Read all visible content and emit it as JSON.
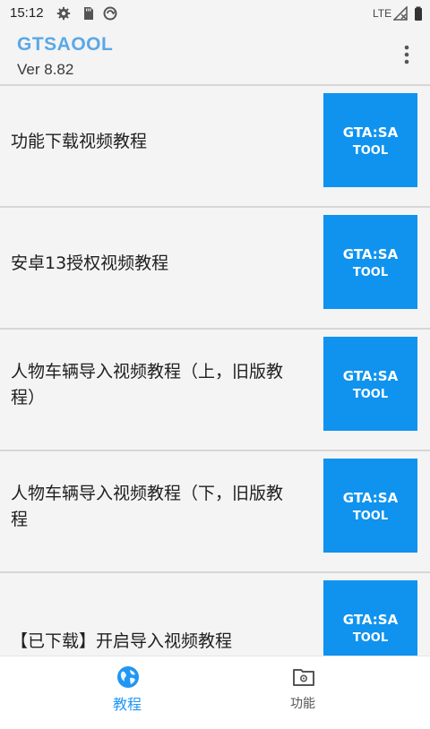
{
  "status_bar": {
    "time": "15:12",
    "network": "LTE",
    "icons": [
      "gear-icon",
      "sd-card-icon",
      "sync-circle-icon",
      "signal-icon",
      "battery-icon"
    ]
  },
  "app_bar": {
    "title": "GTSAOOL",
    "version": "Ver 8.82",
    "menu_icon": "more-vert-icon"
  },
  "items": [
    {
      "label": "功能下载视频教程",
      "thumb_line1": "GTA:SA",
      "thumb_line2": "TOOL"
    },
    {
      "label": "安卓13授权视频教程",
      "thumb_line1": "GTA:SA",
      "thumb_line2": "TOOL"
    },
    {
      "label": "人物车辆导入视频教程（上，旧版教程）",
      "thumb_line1": "GTA:SA",
      "thumb_line2": "TOOL"
    },
    {
      "label": "人物车辆导入视频教程（下，旧版教程",
      "thumb_line1": "GTA:SA",
      "thumb_line2": "TOOL"
    },
    {
      "label": "【已下载】开启导入视频教程",
      "thumb_line1": "GTA:SA",
      "thumb_line2": "TOOL"
    }
  ],
  "bottom_nav": {
    "tabs": [
      {
        "label": "教程",
        "icon": "globe-icon",
        "active": true
      },
      {
        "label": "功能",
        "icon": "folder-gear-icon",
        "active": false
      }
    ]
  },
  "colors": {
    "accent": "#2196f3",
    "title": "#5aa8e6",
    "thumb_bg": "#0f93ef"
  }
}
